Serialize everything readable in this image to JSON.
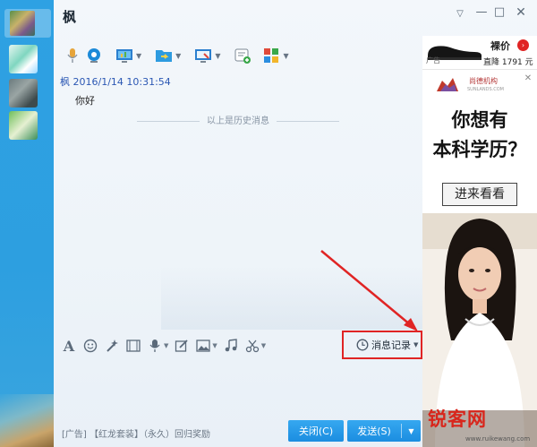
{
  "window": {
    "title": "枫",
    "controls": [
      "dropdown",
      "minimize",
      "maximize",
      "close"
    ]
  },
  "toolbar": {
    "icons": [
      "voice-call-icon",
      "video-call-icon",
      "screen-share-icon",
      "file-transfer-icon",
      "remote-desktop-icon",
      "create-group-icon",
      "apps-icon"
    ]
  },
  "chat": {
    "sender": "枫",
    "timestamp": "2016/1/14 10:31:54",
    "message": "你好",
    "history_separator": "以上是历史消息"
  },
  "input_toolbar": {
    "icons": [
      "font-icon",
      "emoji-icon",
      "magic-icon",
      "gif-icon",
      "voice-message-icon",
      "edit-icon",
      "image-icon",
      "music-icon",
      "scissors-icon"
    ],
    "history_button": "消息记录"
  },
  "footer": {
    "ad_text": "[广告] 【红龙套装】（永久）回归奖励",
    "close_button": "关闭(C)",
    "send_button": "发送(S)"
  },
  "ad": {
    "price_label": "裸价",
    "price_line": "直降 1791 元",
    "tag": "广告",
    "brand": "尚德机构",
    "brand_en": "SUNLANDS.COM",
    "headline1": "你想有",
    "headline2": "本科学历？",
    "cta": "进来看看"
  },
  "watermark": {
    "name": "锐客网",
    "url": "www.ruikewang.com"
  },
  "colors": {
    "accent": "#2fa0e0",
    "sender": "#2b57b3",
    "highlight": "#e02424"
  }
}
